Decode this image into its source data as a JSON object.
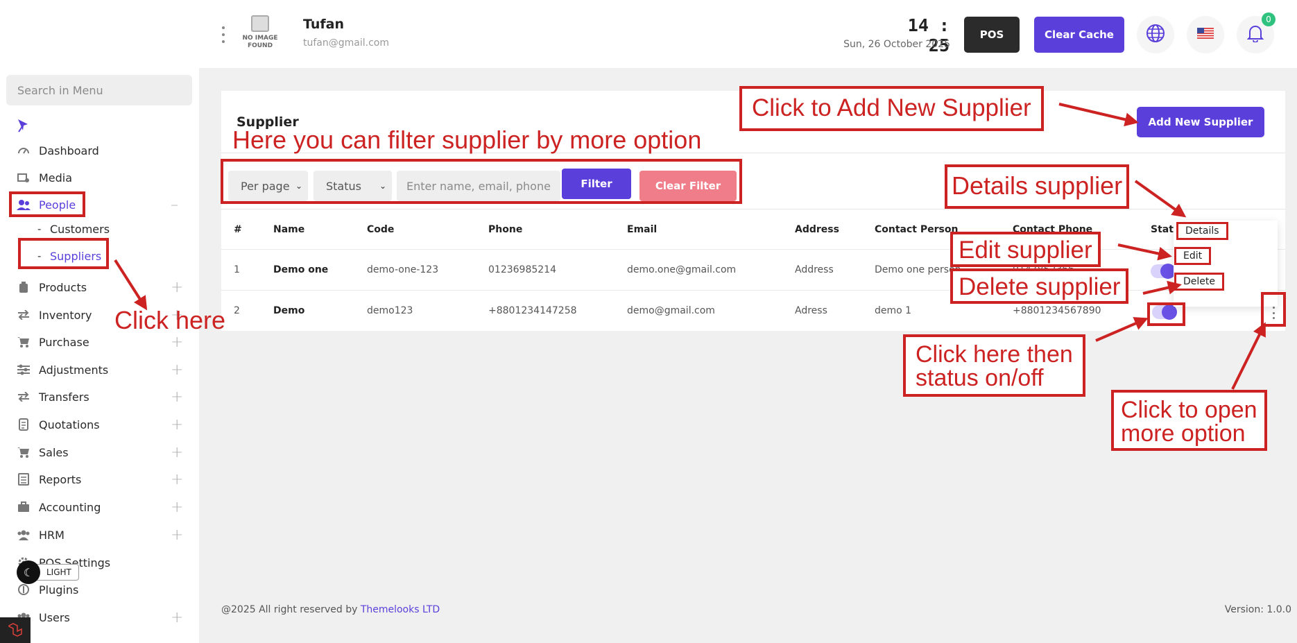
{
  "sidebar": {
    "search_placeholder": "Search in Menu",
    "items": [
      {
        "label": "Dashboard",
        "icon": "gauge-icon"
      },
      {
        "label": "Media",
        "icon": "media-icon"
      },
      {
        "label": "People",
        "icon": "people-icon",
        "toggle": "–"
      },
      {
        "label": "Products",
        "icon": "products-icon",
        "toggle": "+"
      },
      {
        "label": "Inventory",
        "icon": "inventory-icon",
        "toggle": "+"
      },
      {
        "label": "Purchase",
        "icon": "cart-icon",
        "toggle": "+"
      },
      {
        "label": "Adjustments",
        "icon": "sliders-icon",
        "toggle": "+"
      },
      {
        "label": "Transfers",
        "icon": "transfer-icon",
        "toggle": "+"
      },
      {
        "label": "Quotations",
        "icon": "document-icon",
        "toggle": "+"
      },
      {
        "label": "Sales",
        "icon": "cart-icon",
        "toggle": "+"
      },
      {
        "label": "Reports",
        "icon": "report-icon",
        "toggle": "+"
      },
      {
        "label": "Accounting",
        "icon": "briefcase-icon",
        "toggle": "+"
      },
      {
        "label": "HRM",
        "icon": "team-icon",
        "toggle": "+"
      },
      {
        "label": "POS Settings",
        "icon": "gear-icon"
      },
      {
        "label": "Plugins",
        "icon": "plugin-icon"
      },
      {
        "label": "Users",
        "icon": "users-icon",
        "toggle": "+"
      }
    ],
    "sub_items": [
      {
        "dash": "-",
        "label": "Customers"
      },
      {
        "dash": "-",
        "label": "Suppliers"
      }
    ],
    "theme_label": "LIGHT"
  },
  "header": {
    "no_image_line1": "NO IMAGE",
    "no_image_line2": "FOUND",
    "user_name": "Tufan",
    "user_email": "tufan@gmail.com",
    "time": "14 : 25",
    "date": "Sun, 26 October 2025",
    "pos_label": "POS",
    "clear_cache_label": "Clear Cache",
    "notification_count": "0"
  },
  "page": {
    "title": "Supplier",
    "add_button": "Add New Supplier",
    "filters": {
      "per_page": "Per page",
      "status": "Status",
      "search_placeholder": "Enter name, email, phone",
      "filter_button": "Filter",
      "clear_button": "Clear Filter"
    },
    "table": {
      "headers": [
        "#",
        "Name",
        "Code",
        "Phone",
        "Email",
        "Address",
        "Contact Person",
        "Contact Phone",
        "Stat"
      ],
      "rows": [
        [
          "1",
          "Demo one",
          "demo-one-123",
          "01236985214",
          "demo.one@gmail.com",
          "Address",
          "Demo one person",
          "0147852366"
        ],
        [
          "2",
          "Demo",
          "demo123",
          "+8801234147258",
          "demo@gmail.com",
          "Adress",
          "demo 1",
          "+8801234567890"
        ]
      ]
    },
    "dropdown": {
      "details": "Details",
      "edit": "Edit",
      "delete": "Delete"
    }
  },
  "footer": {
    "copyright_prefix": "@2025 All right reserved by ",
    "company": "Themelooks LTD",
    "version": "Version: 1.0.0"
  },
  "annotations": {
    "add_new": "Click to Add New Supplier",
    "filter_hint": "Here you can filter supplier by more option",
    "click_here": "Click here",
    "details": "Details supplier",
    "edit": "Edit supplier",
    "delete": "Delete supplier",
    "status_line1": "Click here then",
    "status_line2": "status on/off",
    "more_line1": "Click to open",
    "more_line2": "more option"
  },
  "colors": {
    "accent": "#5b3fdb",
    "annotation": "#cc2222",
    "clear_filter": "#f07d8a"
  }
}
